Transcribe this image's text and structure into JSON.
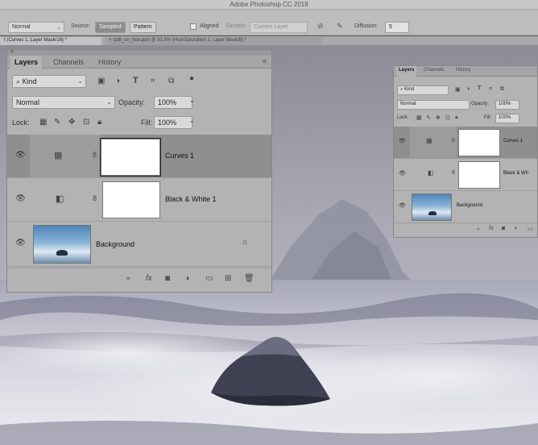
{
  "window": {
    "title": "Adobe Photoshop CC 2018"
  },
  "options_bar": {
    "mode_value": "Normal",
    "source_label": "Source:",
    "source_sampled": "Sampled",
    "source_pattern": "Pattern",
    "aligned_label": "Aligned",
    "sample_label": "Sample:",
    "sample_value": "Current Layer",
    "diffusion_label": "Diffusion:",
    "diffusion_value": "5"
  },
  "doc_tabs": [
    {
      "label": "t (Curves 1, Layer Mask/16) *"
    },
    {
      "label": "× split_on_hue.psd @ 33.3% (Hue/Saturation 1, Layer Mask/8) *"
    }
  ],
  "layers_panel": {
    "tabs": [
      "Layers",
      "Channels",
      "History"
    ],
    "filter_value": "Kind",
    "blend_mode": "Normal",
    "opacity_label": "Opacity:",
    "opacity_value": "100%",
    "lock_label": "Lock:",
    "fill_label": "Fill:",
    "fill_value": "100%",
    "layers": [
      {
        "name": "Curves 1",
        "selected": true,
        "type": "curves"
      },
      {
        "name": "Black & White 1",
        "selected": false,
        "type": "black-white"
      },
      {
        "name": "Background",
        "selected": false,
        "type": "image",
        "locked": true
      }
    ]
  },
  "small_panel": {
    "tabs": [
      "Layers",
      "Channels",
      "History"
    ],
    "filter_value": "Kind",
    "blend_mode": "Normal",
    "opacity_label": "Opacity:",
    "opacity_value": "100%",
    "lock_label": "Lock:",
    "fill_label": "Fill:",
    "fill_value": "100%",
    "layers": [
      {
        "name": "Curves 1",
        "selected": true
      },
      {
        "name": "Black & Wh",
        "selected": false
      },
      {
        "name": "Background",
        "selected": false
      }
    ]
  },
  "colors": {
    "selected_row": "#8f8f8f",
    "panel_bg": "#b3b3b3"
  }
}
